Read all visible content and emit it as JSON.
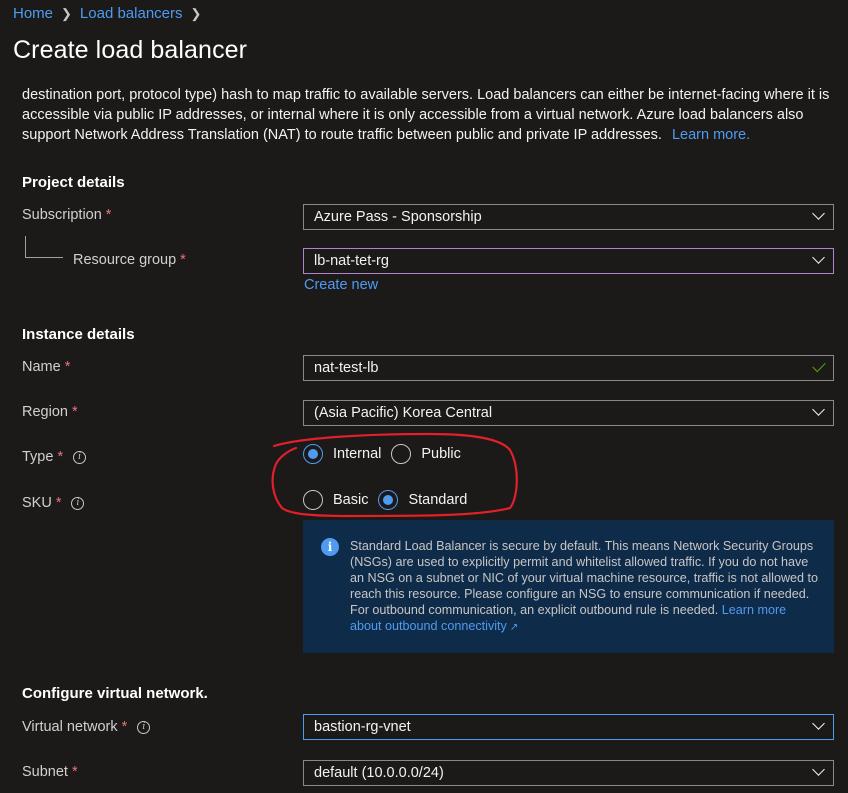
{
  "breadcrumb": {
    "home": "Home",
    "load_balancers": "Load balancers"
  },
  "page_title": "Create load balancer",
  "intro": {
    "text": "destination port, protocol type) hash to map traffic to available servers. Load balancers can either be internet-facing where it is accessible via public IP addresses, or internal where it is only accessible from a virtual network. Azure load balancers also support Network Address Translation (NAT) to route traffic between public and private IP addresses.",
    "learn_more": "Learn more."
  },
  "project_details": {
    "title": "Project details",
    "subscription_label": "Subscription",
    "subscription_value": "Azure Pass - Sponsorship",
    "resource_group_label": "Resource group",
    "resource_group_value": "lb-nat-tet-rg",
    "create_new": "Create new"
  },
  "instance_details": {
    "title": "Instance details",
    "name_label": "Name",
    "name_value": "nat-test-lb",
    "region_label": "Region",
    "region_value": "(Asia Pacific) Korea Central",
    "type_label": "Type",
    "type_options": [
      "Internal",
      "Public"
    ],
    "type_selected": "Internal",
    "sku_label": "SKU",
    "sku_options": [
      "Basic",
      "Standard"
    ],
    "sku_selected": "Standard"
  },
  "info_box": {
    "text": "Standard Load Balancer is secure by default.  This means Network Security Groups (NSGs) are used to explicitly permit and whitelist allowed traffic. If you do not have an NSG on a subnet or NIC of your virtual machine resource, traffic is not allowed to reach this resource. Please configure an NSG to ensure communication if needed.  For outbound communication, an explicit outbound rule is needed.",
    "link": "Learn more about outbound connectivity"
  },
  "virtual_network": {
    "title": "Configure virtual network.",
    "vnet_label": "Virtual network",
    "vnet_value": "bastion-rg-vnet",
    "subnet_label": "Subnet",
    "subnet_value": "default (10.0.0.0/24)"
  },
  "required_marker": "*",
  "colors": {
    "background": "#1b1a19",
    "link": "#4f9bf2",
    "required": "#f1707b",
    "info_bg": "#0f2b4a",
    "annotation": "#e0202a"
  }
}
